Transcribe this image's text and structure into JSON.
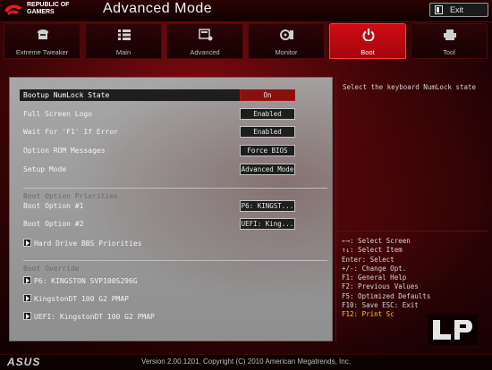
{
  "header": {
    "brand_line1": "REPUBLIC OF",
    "brand_line2": "GAMERS",
    "title": "Advanced Mode",
    "exit_label": "Exit"
  },
  "tabs": [
    {
      "label": "Extreme Tweaker",
      "icon": "tweaker-icon",
      "active": false
    },
    {
      "label": "Main",
      "icon": "list-icon",
      "active": false
    },
    {
      "label": "Advanced",
      "icon": "advanced-icon",
      "active": false
    },
    {
      "label": "Monitor",
      "icon": "monitor-icon",
      "active": false
    },
    {
      "label": "Boot",
      "icon": "power-icon",
      "active": true
    },
    {
      "label": "Tool",
      "icon": "printer-icon",
      "active": false
    }
  ],
  "settings": [
    {
      "label": "Bootup NumLock State",
      "value": "On",
      "selected": true
    },
    {
      "label": "Full Screen Logo",
      "value": "Enabled"
    },
    {
      "label": "Wait For 'F1' If Error",
      "value": "Enabled"
    },
    {
      "label": "Option ROM Messages",
      "value": "Force BIOS"
    },
    {
      "label": "Setup Mode",
      "value": "Advanced Mode"
    }
  ],
  "boot_priorities": {
    "heading": "Boot Option Priorities",
    "items": [
      {
        "label": "Boot Option #1",
        "value": "P6: KINGST..."
      },
      {
        "label": "Boot Option #2",
        "value": "UEFI: King..."
      }
    ],
    "submenu": "Hard Drive BBS Priorities"
  },
  "boot_override": {
    "heading": "Boot Override",
    "items": [
      "P6: KINGSTON SVP100S296G",
      "KingstonDT 100 G2 PMAP",
      "UEFI: KingstonDT 100 G2 PMAP"
    ]
  },
  "help": {
    "description": "Select the keyboard NumLock state",
    "keys": [
      "←→: Select Screen",
      "↑↓: Select Item",
      "Enter: Select",
      "+/-: Change Opt.",
      "F1: General Help",
      "F2: Previous Values",
      "F5: Optimized Defaults",
      "F10: Save  ESC: Exit",
      "F12: Print Sc"
    ]
  },
  "footer": {
    "brand": "ASUS",
    "version": "Version 2.00.1201. Copyright (C) 2010 American Megatrends, Inc."
  },
  "colors": {
    "accent": "#d10a14",
    "selected_value": "#8a1010",
    "highlight_key": "#f2d21b"
  }
}
